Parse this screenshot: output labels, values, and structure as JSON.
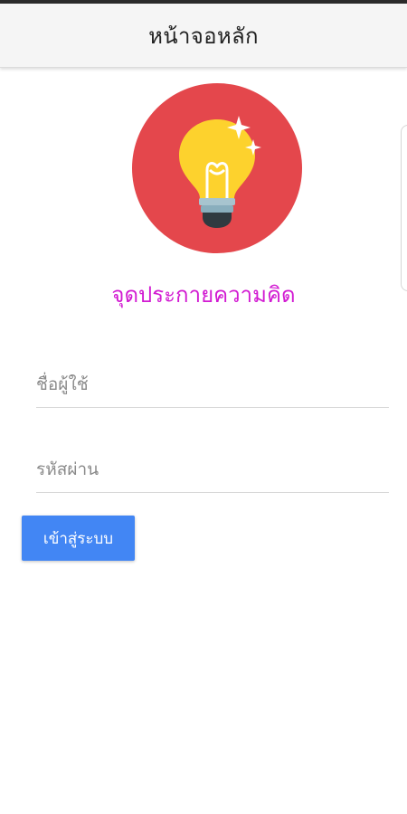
{
  "app_bar": {
    "title": "หน้าจอหลัก"
  },
  "logo": {
    "icon": "lightbulb-icon",
    "circle_color": "#e4474c",
    "bulb_color": "#fdd22d",
    "sparkle_color": "#ffffff"
  },
  "brand": {
    "title": "จุดประกายความคิด",
    "color": "#d21bd2"
  },
  "form": {
    "username": {
      "placeholder": "ชื่อผู้ใช้",
      "value": ""
    },
    "password": {
      "placeholder": "รหัสผ่าน",
      "value": ""
    },
    "login_label": "เข้าสู่ระบบ",
    "login_color": "#4286f4"
  }
}
